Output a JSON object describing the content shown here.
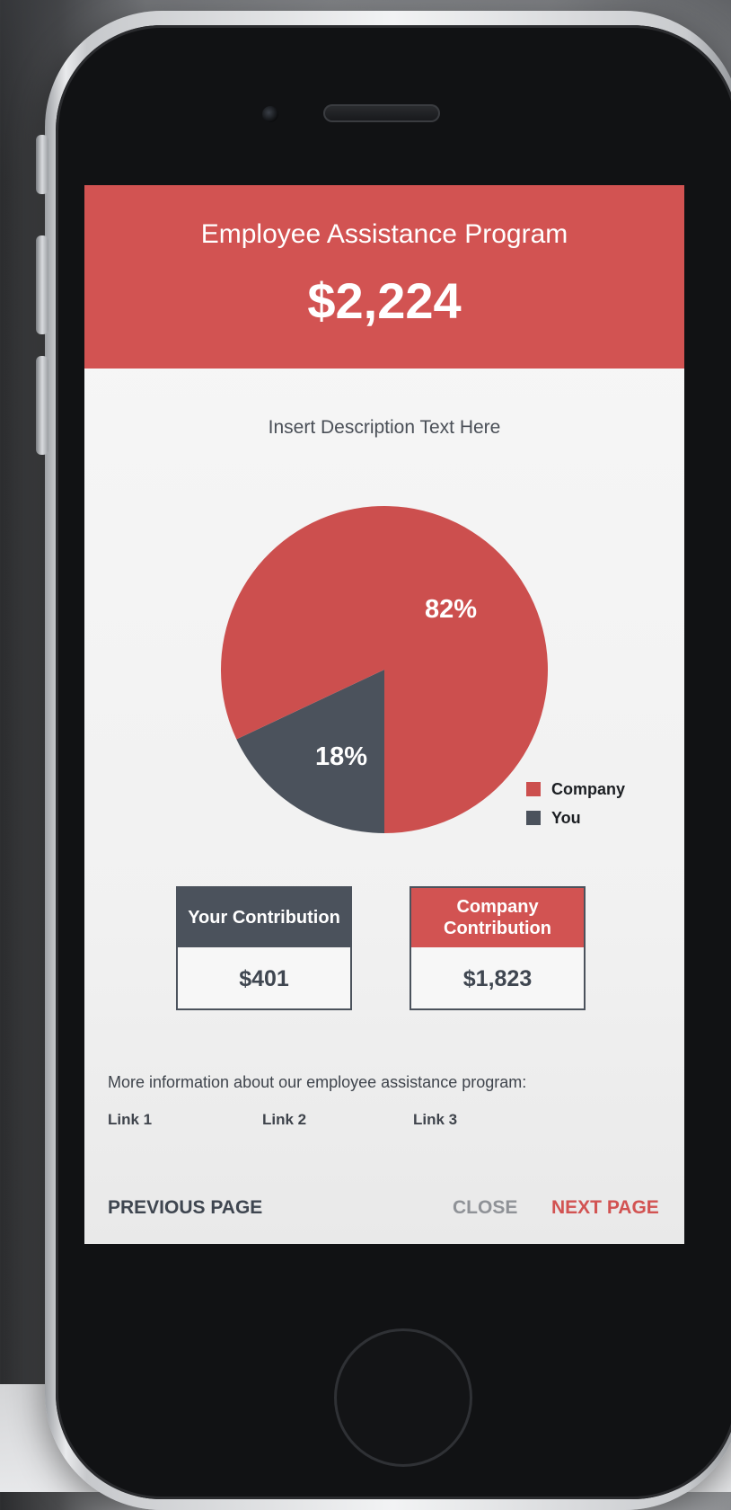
{
  "header": {
    "title": "Employee Assistance Program",
    "amount": "$2,224"
  },
  "description": "Insert Description Text Here",
  "chart_data": {
    "type": "pie",
    "slices": [
      {
        "name": "Company",
        "value": 82,
        "label": "82%",
        "color": "#cc4f4e"
      },
      {
        "name": "You",
        "value": 18,
        "label": "18%",
        "color": "#4b525c"
      }
    ],
    "legend_placement": "bottom-right"
  },
  "legend": [
    {
      "label": "Company",
      "color": "#cc4f4e"
    },
    {
      "label": "You",
      "color": "#4b525c"
    }
  ],
  "contributions": {
    "yours": {
      "title": "Your Contribution",
      "value": "$401",
      "color": "#4b525c"
    },
    "company": {
      "title": "Company Contribution",
      "value": "$1,823",
      "color": "#d25352"
    }
  },
  "info": {
    "text": "More information about our employee assistance program:",
    "links": [
      "Link 1",
      "Link 2",
      "Link 3"
    ]
  },
  "footer": {
    "previous": "PREVIOUS PAGE",
    "close": "CLOSE",
    "next": "NEXT PAGE",
    "accent": "#d25352"
  }
}
